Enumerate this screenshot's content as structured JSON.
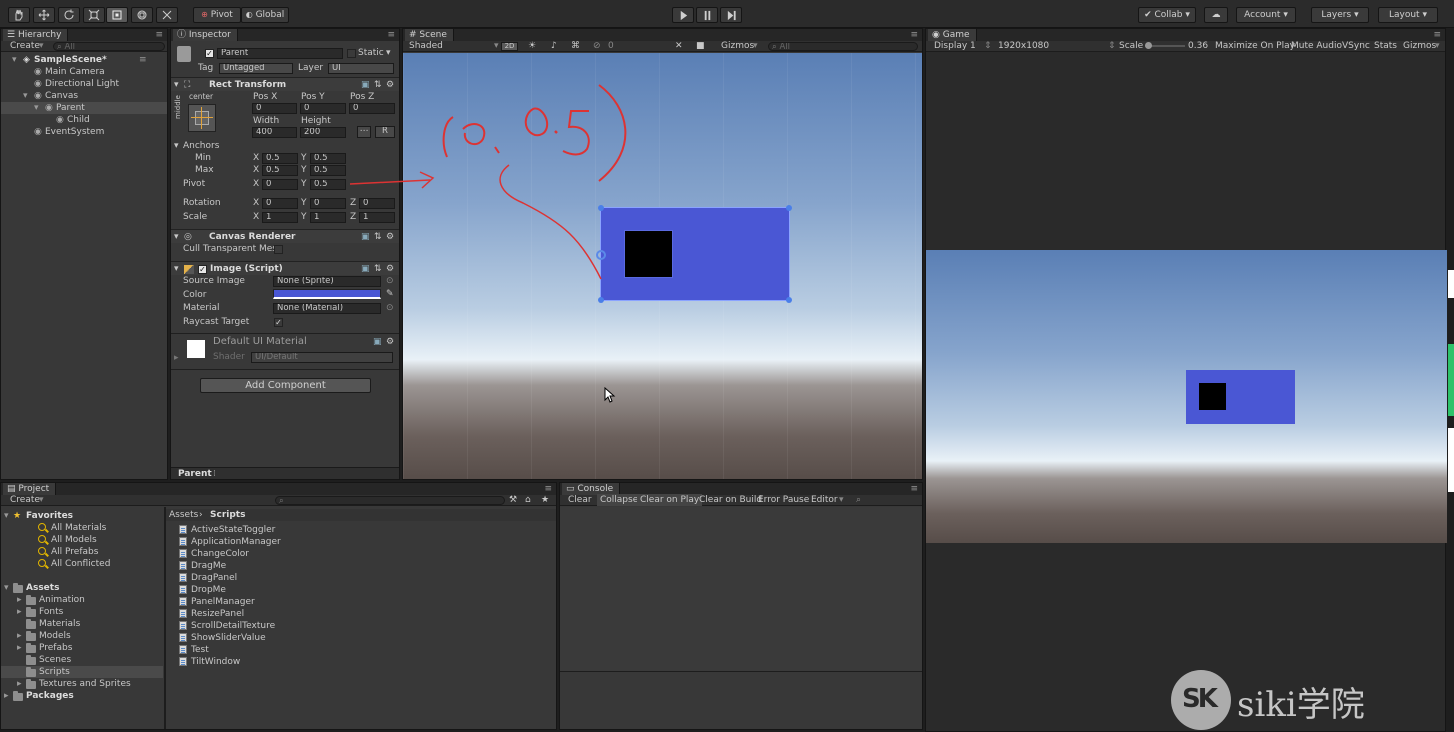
{
  "toolbar": {
    "pivot": "Pivot",
    "global": "Global",
    "collab": "Collab",
    "account": "Account",
    "layers": "Layers",
    "layout": "Layout"
  },
  "hierarchy": {
    "tab": "Hierarchy",
    "create": "Create",
    "search_placeholder": "All",
    "items": [
      {
        "label": "SampleScene*",
        "depth": 0,
        "bold": true
      },
      {
        "label": "Main Camera",
        "depth": 1
      },
      {
        "label": "Directional Light",
        "depth": 1
      },
      {
        "label": "Canvas",
        "depth": 1
      },
      {
        "label": "Parent",
        "depth": 2,
        "selected": true
      },
      {
        "label": "Child",
        "depth": 3
      },
      {
        "label": "EventSystem",
        "depth": 1
      }
    ]
  },
  "inspector": {
    "tab": "Inspector",
    "object_name": "Parent",
    "static_label": "Static",
    "tag_label": "Tag",
    "tag_value": "Untagged",
    "layer_label": "Layer",
    "layer_value": "UI",
    "rect_transform": {
      "title": "Rect Transform",
      "anchor_preset_h": "center",
      "anchor_preset_v": "middle",
      "pos_x_label": "Pos X",
      "pos_y_label": "Pos Y",
      "pos_z_label": "Pos Z",
      "pos_x": "0",
      "pos_y": "0",
      "pos_z": "0",
      "width_label": "Width",
      "height_label": "Height",
      "width": "400",
      "height": "200",
      "blueprint": "R",
      "anchors_label": "Anchors",
      "min_label": "Min",
      "max_label": "Max",
      "pivot_label": "Pivot",
      "x": "X",
      "y": "Y",
      "z": "Z",
      "min_x": "0.5",
      "min_y": "0.5",
      "max_x": "0.5",
      "max_y": "0.5",
      "pivot_x": "0",
      "pivot_y": "0.5",
      "rotation_label": "Rotation",
      "rot_x": "0",
      "rot_y": "0",
      "rot_z": "0",
      "scale_label": "Scale",
      "scale_x": "1",
      "scale_y": "1",
      "scale_z": "1"
    },
    "canvas_renderer": {
      "title": "Canvas Renderer",
      "cull_label": "Cull Transparent Mes"
    },
    "image": {
      "title": "Image (Script)",
      "source_label": "Source Image",
      "source_value": "None (Sprite)",
      "color_label": "Color",
      "color_value": "#4a57d4",
      "material_label": "Material",
      "material_value": "None (Material)",
      "raycast_label": "Raycast Target"
    },
    "material": {
      "title": "Default UI Material",
      "shader_label": "Shader",
      "shader_value": "UI/Default"
    },
    "add_component": "Add Component",
    "footer": "Parent"
  },
  "scene": {
    "tab": "Scene",
    "shading": "Shaded",
    "mode_2d": "2D",
    "gizmos": "Gizmos",
    "search_placeholder": "All",
    "effects_count": "0",
    "annotation": "(0, 0.5)"
  },
  "game": {
    "tab": "Game",
    "display": "Display 1",
    "resolution": "1920x1080",
    "scale_label": "Scale",
    "scale_value": "0.36",
    "maximize": "Maximize On Play",
    "mute": "Mute Audio",
    "vsync": "VSync",
    "stats": "Stats",
    "gizmos": "Gizmos"
  },
  "project": {
    "tab": "Project",
    "create": "Create",
    "favorites_label": "Favorites",
    "favorites": [
      "All Materials",
      "All Models",
      "All Prefabs",
      "All Conflicted"
    ],
    "assets_label": "Assets",
    "asset_folders": [
      "Animation",
      "Fonts",
      "Materials",
      "Models",
      "Prefabs",
      "Scenes",
      "Scripts",
      "Textures and Sprites"
    ],
    "packages_label": "Packages",
    "breadcrumb_root": "Assets",
    "breadcrumb_current": "Scripts",
    "scripts": [
      "ActiveStateToggler",
      "ApplicationManager",
      "ChangeColor",
      "DragMe",
      "DragPanel",
      "DropMe",
      "PanelManager",
      "ResizePanel",
      "ScrollDetailTexture",
      "ShowSliderValue",
      "Test",
      "TiltWindow"
    ]
  },
  "console": {
    "tab": "Console",
    "clear": "Clear",
    "collapse": "Collapse",
    "clear_on_play": "Clear on Play",
    "clear_on_build": "Clear on Build",
    "error_pause": "Error Pause",
    "editor": "Editor"
  },
  "watermark": {
    "text": "siki学院"
  }
}
